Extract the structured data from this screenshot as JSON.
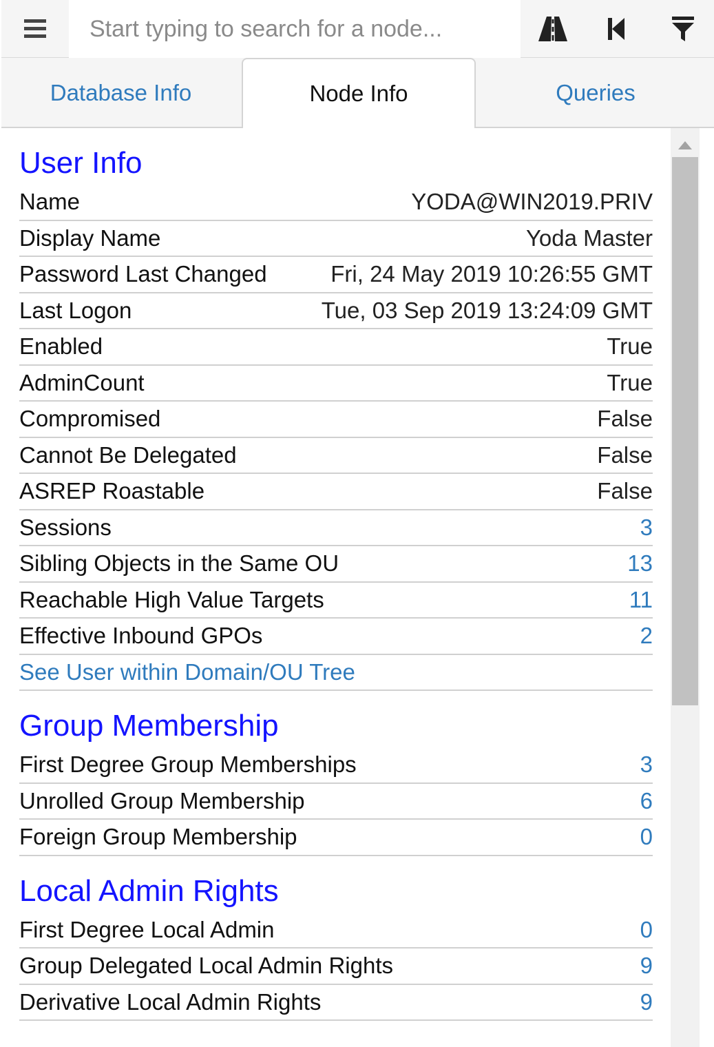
{
  "toolbar": {
    "menu_icon": "hamburger-menu-icon",
    "search_placeholder": "Start typing to search for a node...",
    "search_value": "",
    "pathfinding_icon": "road-icon",
    "back_icon": "step-backward-icon",
    "filter_icon": "filter-icon"
  },
  "tabs": [
    {
      "label": "Database Info",
      "active": false
    },
    {
      "label": "Node Info",
      "active": true
    },
    {
      "label": "Queries",
      "active": false
    }
  ],
  "user_info": {
    "title": "User Info",
    "rows": [
      {
        "label": "Name",
        "value": "YODA@WIN2019.PRIV"
      },
      {
        "label": "Display Name",
        "value": "Yoda Master"
      },
      {
        "label": "Password Last Changed",
        "value": "Fri, 24 May 2019 10:26:55 GMT"
      },
      {
        "label": "Last Logon",
        "value": "Tue, 03 Sep 2019 13:24:09 GMT"
      },
      {
        "label": "Enabled",
        "value": "True"
      },
      {
        "label": "AdminCount",
        "value": "True"
      },
      {
        "label": "Compromised",
        "value": "False"
      },
      {
        "label": "Cannot Be Delegated",
        "value": "False"
      },
      {
        "label": "ASREP Roastable",
        "value": "False"
      },
      {
        "label": "Sessions",
        "value": "3"
      },
      {
        "label": "Sibling Objects in the Same OU",
        "value": "13"
      },
      {
        "label": "Reachable High Value Targets",
        "value": "11"
      },
      {
        "label": "Effective Inbound GPOs",
        "value": "2"
      }
    ],
    "tree_link": "See User within Domain/OU Tree"
  },
  "group_membership": {
    "title": "Group Membership",
    "rows": [
      {
        "label": "First Degree Group Memberships",
        "value": "3"
      },
      {
        "label": "Unrolled Group Membership",
        "value": "6"
      },
      {
        "label": "Foreign Group Membership",
        "value": "0"
      }
    ]
  },
  "local_admin": {
    "title": "Local Admin Rights",
    "rows": [
      {
        "label": "First Degree Local Admin",
        "value": "0"
      },
      {
        "label": "Group Delegated Local Admin Rights",
        "value": "9"
      },
      {
        "label": "Derivative Local Admin Rights",
        "value": "9"
      }
    ]
  },
  "colors": {
    "section_title": "#1414ff",
    "link": "#2f7bbd",
    "toolbar_bg": "#f5f5f5",
    "scroll_thumb": "#c1c1c1"
  }
}
